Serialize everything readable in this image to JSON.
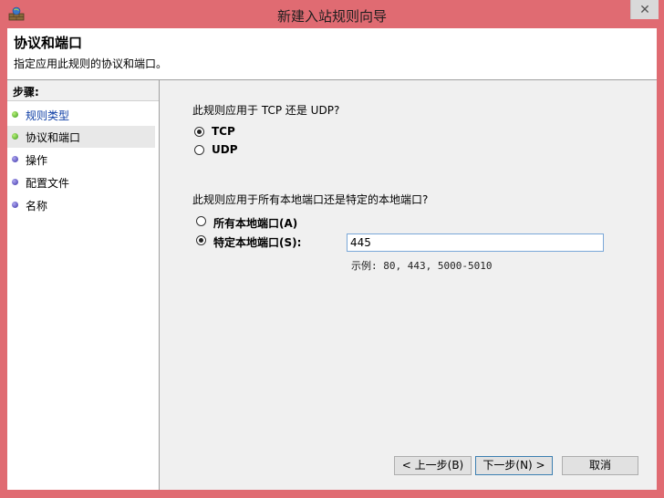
{
  "window": {
    "title": "新建入站规则向导"
  },
  "header": {
    "title": "协议和端口",
    "subtitle": "指定应用此规则的协议和端口。"
  },
  "steps": {
    "heading": "步骤:",
    "items": [
      {
        "label": "规则类型"
      },
      {
        "label": "协议和端口"
      },
      {
        "label": "操作"
      },
      {
        "label": "配置文件"
      },
      {
        "label": "名称"
      }
    ]
  },
  "protocol": {
    "question": "此规则应用于 TCP 还是 UDP?",
    "options": [
      {
        "label": "TCP",
        "checked": true
      },
      {
        "label": "UDP",
        "checked": false
      }
    ]
  },
  "ports": {
    "question": "此规则应用于所有本地端口还是特定的本地端口?",
    "options": [
      {
        "label": "所有本地端口(A)",
        "checked": false
      },
      {
        "label": "特定本地端口(S):",
        "checked": true
      }
    ],
    "value": "445",
    "example": "示例: 80, 443, 5000-5010"
  },
  "buttons": {
    "back": "< 上一步(B)",
    "next": "下一步(N) >",
    "cancel": "取消"
  },
  "colors": {
    "frame": "#e06b72",
    "link": "#0f3fa6",
    "panel": "#f0f0f0"
  }
}
